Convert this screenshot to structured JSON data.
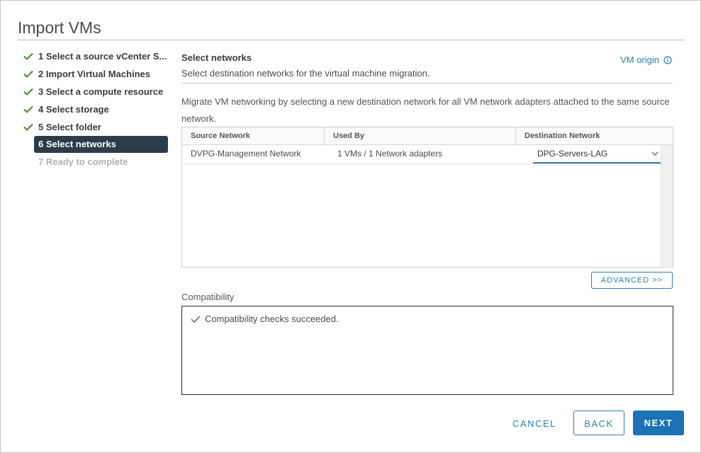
{
  "dialog": {
    "title": "Import VMs"
  },
  "steps": [
    {
      "label": "1 Select a source vCenter S...",
      "state": "done"
    },
    {
      "label": "2 Import Virtual Machines",
      "state": "done"
    },
    {
      "label": "3 Select a compute resource",
      "state": "done"
    },
    {
      "label": "4 Select storage",
      "state": "done"
    },
    {
      "label": "5 Select folder",
      "state": "done"
    },
    {
      "label": "6 Select networks",
      "state": "active"
    },
    {
      "label": "7 Ready to complete",
      "state": "disabled"
    }
  ],
  "section": {
    "title": "Select networks",
    "subtitle": "Select destination networks for the virtual machine migration.",
    "vm_origin_label": "VM origin",
    "description": "Migrate VM networking by selecting a new destination network for all VM network adapters attached to the same source network."
  },
  "grid": {
    "columns": [
      "Source Network",
      "Used By",
      "Destination Network"
    ],
    "rows": [
      {
        "source_network": "DVPG-Management Network",
        "used_by": "1 VMs / 1 Network adapters",
        "destination_network": "DPG-Servers-LAG"
      }
    ]
  },
  "advanced_button": "ADVANCED >>",
  "compatibility": {
    "label": "Compatibility",
    "message": "Compatibility checks succeeded."
  },
  "footer": {
    "cancel": "CANCEL",
    "back": "BACK",
    "next": "NEXT"
  },
  "colors": {
    "accent": "#2a7eb8",
    "success_check": "#4d8f37",
    "active_step_bg": "#2d3c4a",
    "primary_button": "#1b72b5"
  }
}
